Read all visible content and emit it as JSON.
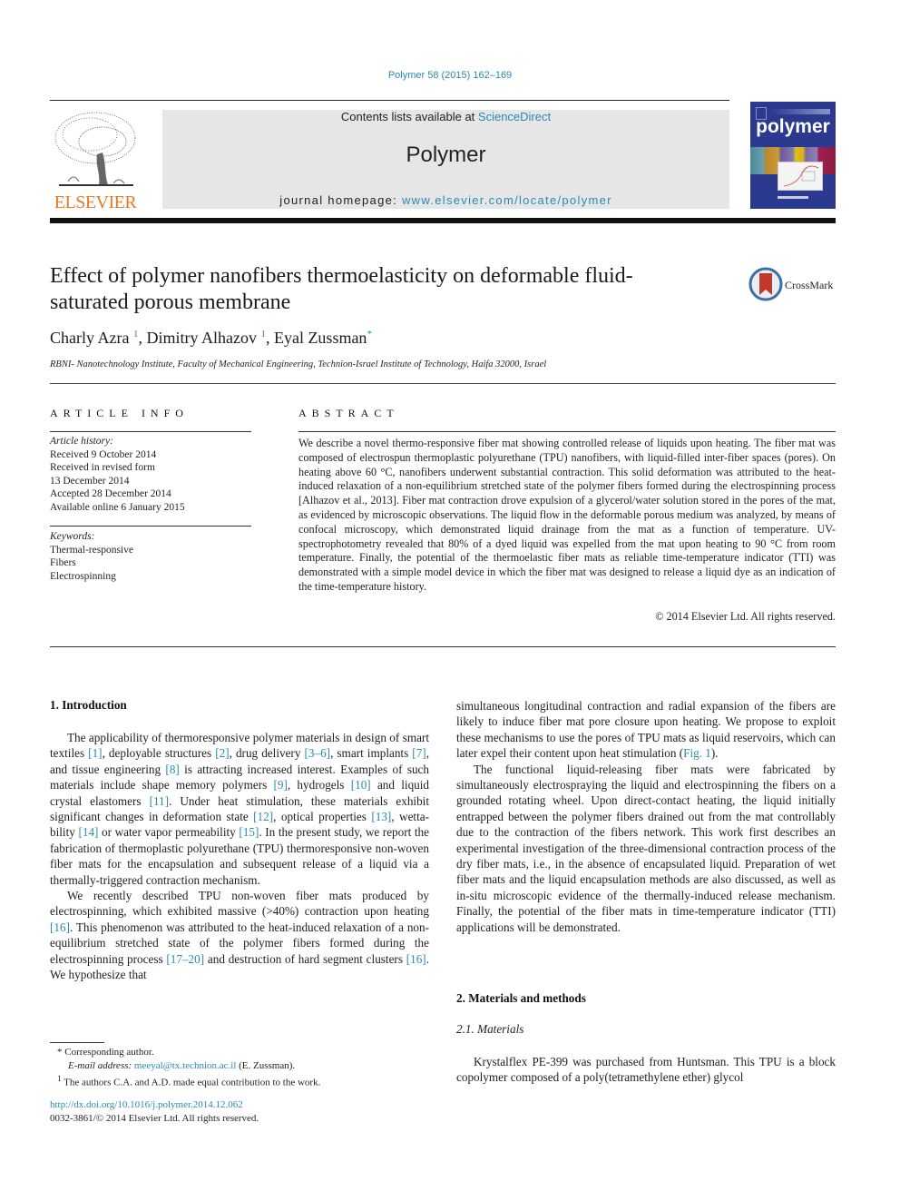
{
  "header": {
    "citation": "Polymer 58 (2015) 162–169",
    "contents_prefix": "Contents lists available at ",
    "contents_link": "ScienceDirect",
    "journal_name": "Polymer",
    "homepage_prefix": "journal homepage: ",
    "homepage_link": "www.elsevier.com/locate/polymer",
    "publisher_logo_text": "ELSEVIER",
    "cover_title": "polymer",
    "colors": {
      "link": "#2a8ab0",
      "publisher_orange": "#e87a1e",
      "band_gray": "#e6e6e6",
      "cover_blue": "#2b3a8f"
    }
  },
  "article": {
    "title": "Effect of polymer nanofibers thermoelasticity on deformable fluid-saturated porous membrane",
    "crossmark_label": "CrossMark",
    "authors": [
      {
        "name": "Charly Azra",
        "mark": "1",
        "sep": ", "
      },
      {
        "name": "Dimitry Alhazov",
        "mark": "1",
        "sep": ", "
      },
      {
        "name": "Eyal Zussman",
        "mark": "*",
        "sep": ""
      }
    ],
    "affiliation": "RBNI- Nanotechnology Institute, Faculty of Mechanical Engineering, Technion-Israel Institute of Technology, Haifa 32000, Israel"
  },
  "article_info": {
    "heading": "ARTICLE INFO",
    "history_label": "Article history:",
    "history": [
      "Received 9 October 2014",
      "Received in revised form",
      "13 December 2014",
      "Accepted 28 December 2014",
      "Available online 6 January 2015"
    ],
    "keywords_label": "Keywords:",
    "keywords": [
      "Thermal-responsive",
      "Fibers",
      "Electrospinning"
    ]
  },
  "abstract": {
    "heading": "ABSTRACT",
    "text": "We describe a novel thermo-responsive fiber mat showing controlled release of liquids upon heating. The fiber mat was composed of electrospun thermoplastic polyurethane (TPU) nanofibers, with liquid-filled inter-fiber spaces (pores). On heating above 60 °C, nanofibers underwent substantial contraction. This solid deformation was attributed to the heat-induced relaxation of a non-equilibrium stretched state of the polymer fibers formed during the electrospinning process [Alhazov et al., 2013]. Fiber mat contraction drove expulsion of a glycerol/water solution stored in the pores of the mat, as evidenced by microscopic observations. The liquid flow in the deformable porous medium was analyzed, by means of confocal microscopy, which demonstrated liquid drainage from the mat as a function of temperature. UV-spectrophotometry revealed that 80% of a dyed liquid was expelled from the mat upon heating to 90 °C from room temperature. Finally, the potential of the thermoelastic fiber mats as reliable time-temperature indicator (TTI) was demonstrated with a simple model device in which the fiber mat was designed to release a liquid dye as an indication of the time-temperature history.",
    "copyright": "© 2014 Elsevier Ltd. All rights reserved."
  },
  "body": {
    "sec1_heading": "1.  Introduction",
    "intro_p1": [
      {
        "t": "The applicability of thermoresponsive polymer materials in design of smart textiles "
      },
      {
        "r": "[1]"
      },
      {
        "t": ", deployable structures "
      },
      {
        "r": "[2]"
      },
      {
        "t": ", drug delivery "
      },
      {
        "r": "[3–6]"
      },
      {
        "t": ", smart implants "
      },
      {
        "r": "[7]"
      },
      {
        "t": ", and tissue engineering "
      },
      {
        "r": "[8]"
      },
      {
        "t": " is attracting increased interest. Examples of such materials include shape memory polymers "
      },
      {
        "r": "[9]"
      },
      {
        "t": ", hydrogels "
      },
      {
        "r": "[10]"
      },
      {
        "t": " and liquid crystal elastomers "
      },
      {
        "r": "[11]"
      },
      {
        "t": ". Under heat stimulation, these materials exhibit significant changes in deformation state "
      },
      {
        "r": "[12]"
      },
      {
        "t": ", optical properties "
      },
      {
        "r": "[13]"
      },
      {
        "t": ", wetta­bility "
      },
      {
        "r": "[14]"
      },
      {
        "t": " or water vapor permeability "
      },
      {
        "r": "[15]"
      },
      {
        "t": ". In the present study, we report the fabrication of thermoplastic polyurethane (TPU) ther­moresponsive non-woven fiber mats for the encapsulation and subsequent release of a liquid via a thermally-triggered contraction mechanism."
      }
    ],
    "intro_p2": [
      {
        "t": "We recently described TPU non-woven fiber mats produced by electrospinning, which exhibited massive (>40%) contraction upon heating "
      },
      {
        "r": "[16]"
      },
      {
        "t": ". This phenomenon was attributed to the heat-induced relaxation of a non-equilibrium stretched state of the polymer fi­bers formed during the electrospinning process "
      },
      {
        "r": "[17–20]"
      },
      {
        "t": " and destruction of hard segment clusters "
      },
      {
        "r": "[16]"
      },
      {
        "t": ". We hypothesize that"
      }
    ],
    "right_p1": [
      {
        "t": "simultaneous longitudinal contraction and radial expansion of the fibers are likely to induce fiber mat pore closure upon heating. We propose to exploit these mechanisms to use the pores of TPU mats as liquid reservoirs, which can later expel their content upon heat stimulation ("
      },
      {
        "r": "Fig. 1"
      },
      {
        "t": ")."
      }
    ],
    "right_p2": [
      {
        "t": "The functional liquid-releasing fiber mats were fabricated by simultaneously electrospraying the liquid and electrospinning the fibers on a grounded rotating wheel. Upon direct-contact heating, the liquid initially entrapped between the polymer fibers drained out from the mat controllably due to the contraction of the fibers network. This work first describes an experimental investigation of the three-dimensional contraction process of the dry fiber mats, i.e., in the absence of encapsulated liquid. Preparation of wet fiber mats and the liquid encapsulation methods are also discussed, as well as in-situ microscopic evidence of the thermally-induced release mechanism. Finally, the potential of the fiber mats in time-temperature indicator (TTI) applications will be demonstrated."
      }
    ],
    "sec2_heading": "2.  Materials and methods",
    "sub21_heading": "2.1.  Materials",
    "materials_p1": [
      {
        "t": "Krystalflex PE-399 was purchased from Huntsman. This TPU is a block copolymer composed of a poly(tetramethylene ether) glycol"
      }
    ]
  },
  "footnotes": {
    "corresponding": "* Corresponding author.",
    "email_label": "E-mail address: ",
    "email": "meeyal@tx.technion.ac.il",
    "email_suffix": " (E. Zussman).",
    "equal_mark": "1",
    "equal_text": "The authors C.A. and A.D. made equal contribution to the work.",
    "doi": "http://dx.doi.org/10.1016/j.polymer.2014.12.062",
    "issn": "0032-3861/© 2014 Elsevier Ltd. All rights reserved."
  }
}
